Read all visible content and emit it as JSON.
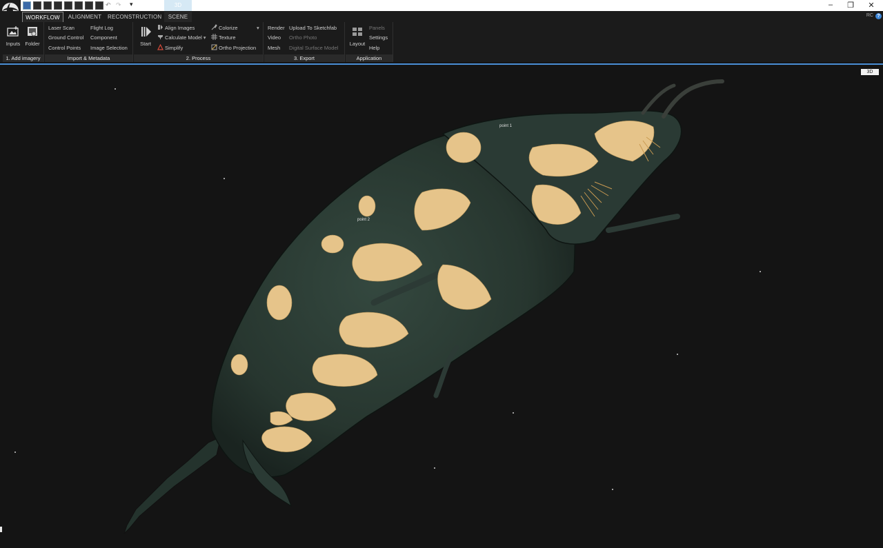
{
  "window": {
    "title_tab": "3D",
    "controls": {
      "minimize": "–",
      "restore": "❐",
      "close": "✕"
    },
    "user_badge": "RC",
    "help_glyph": "?"
  },
  "quick_access": {
    "dropdown_glyph": "▾"
  },
  "tabs": [
    "WORKFLOW",
    "ALIGNMENT",
    "RECONSTRUCTION",
    "SCENE"
  ],
  "active_tab": "WORKFLOW",
  "ribbon": {
    "add_imagery": {
      "caption": "1. Add imagery",
      "inputs": "Inputs",
      "folder": "Folder"
    },
    "import_metadata": {
      "caption": "Import & Metadata",
      "laser_scan": "Laser Scan",
      "ground_control": "Ground Control",
      "control_points": "Control Points",
      "flight_log": "Flight Log",
      "component": "Component",
      "image_selection": "Image Selection"
    },
    "process": {
      "caption": "2. Process",
      "start": "Start",
      "align_images": "Align Images",
      "calculate_model": "Calculate Model",
      "simplify": "Simplify",
      "colorize": "Colorize",
      "texture": "Texture",
      "ortho_projection": "Ortho Projection"
    },
    "export": {
      "caption": "3. Export",
      "render": "Render",
      "video": "Video",
      "mesh": "Mesh",
      "upload_sketchfab": "Upload To Sketchfab",
      "ortho_photo": "Ortho Photo",
      "digital_surface_model": "Digital Surface Model"
    },
    "application": {
      "caption": "Application",
      "layout": "Layout",
      "panels": "Panels",
      "settings": "Settings",
      "help": "Help"
    }
  },
  "viewport": {
    "mode_badge": "3D",
    "point_labels": [
      "point 1",
      "point 2"
    ]
  },
  "colors": {
    "accent": "#4a8fd6",
    "background": "#141414",
    "shell_green": "#2c3d38",
    "pattern_tan": "#e6c48a"
  }
}
